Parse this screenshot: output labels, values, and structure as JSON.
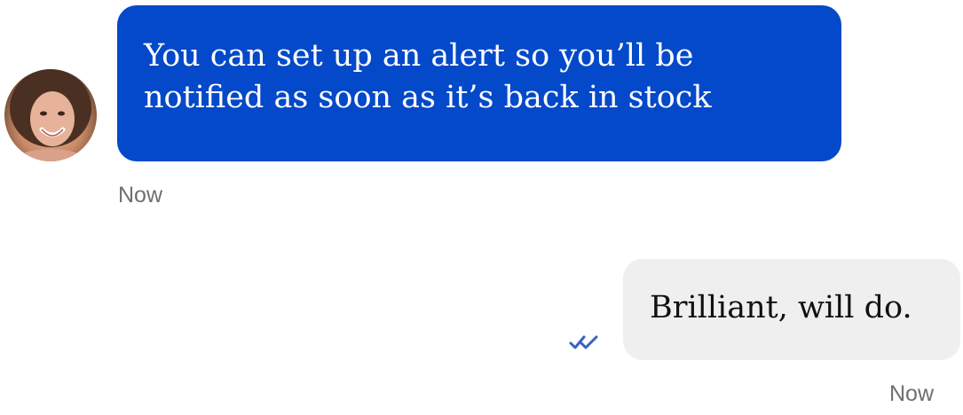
{
  "conversation": {
    "incoming": {
      "text": "You can set up an alert so you’ll be notified as soon as it’s back in stock",
      "time": "Now",
      "avatar": "agent-avatar",
      "bubble_color": "#0349c9"
    },
    "outgoing": {
      "text": "Brilliant, will do.",
      "time": "Now",
      "status_icon": "double-check-icon",
      "bubble_color": "#efefef",
      "check_color": "#3a5fc8"
    }
  }
}
